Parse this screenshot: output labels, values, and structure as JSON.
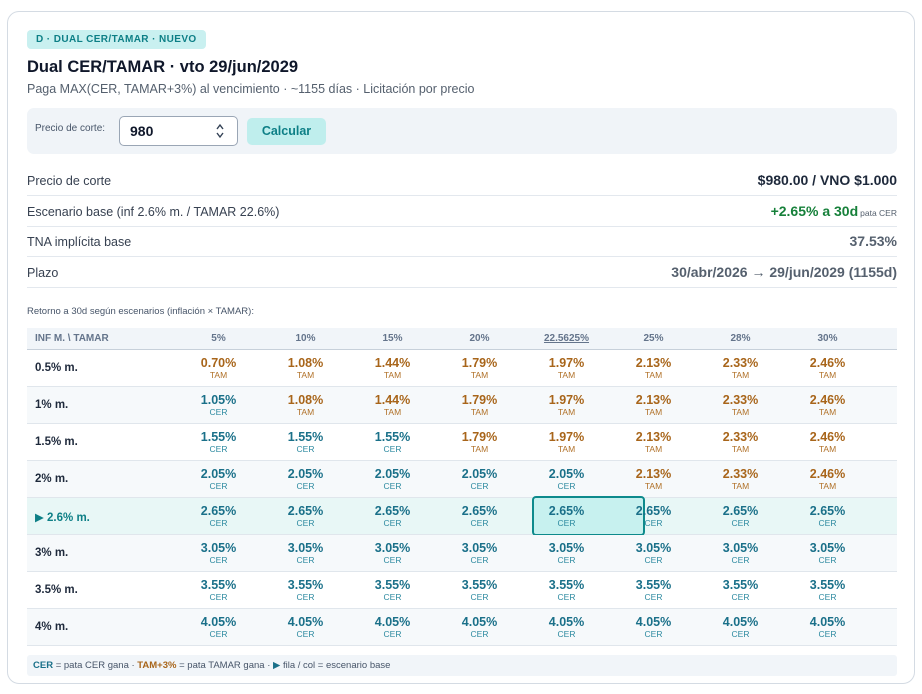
{
  "badge": "D · DUAL CER/TAMAR · NUEVO",
  "title": "Dual CER/TAMAR · vto 29/jun/2029",
  "subtitle": "Paga MAX(CER, TAMAR+3%) al vencimiento · ~1155 días · Licitación por precio",
  "calculator": {
    "label": "Precio de corte:",
    "input_value": "980",
    "button_label": "Calcular"
  },
  "summary": [
    {
      "label": "Precio de corte",
      "value": "$980.00 / VNO $1.000",
      "note": ""
    },
    {
      "label": "Escenario base (inf 2.6% m. / TAMAR 22.6%)",
      "value": "+2.65% a 30d",
      "note": "pata CER"
    },
    {
      "label": "TNA implícita base",
      "value": "37.53%",
      "note": ""
    },
    {
      "label": "Plazo",
      "value": "30/abr/2026 → 29/jun/2029 (1155d)",
      "note": ""
    }
  ],
  "scenario_caption": "Retorno a 30d según escenarios (inflación × TAMAR):",
  "grid": {
    "corner_header": "INF M. \\ TAMAR",
    "columns": [
      "5%",
      "10%",
      "15%",
      "20%",
      "22.5625%",
      "25%",
      "28%",
      "30%"
    ],
    "base_column_index": 4,
    "base_row_index": 4,
    "rows": [
      {
        "label": "0.5% m.",
        "cells": [
          {
            "v": "0.70%",
            "t": "TAM"
          },
          {
            "v": "1.08%",
            "t": "TAM"
          },
          {
            "v": "1.44%",
            "t": "TAM"
          },
          {
            "v": "1.79%",
            "t": "TAM"
          },
          {
            "v": "1.97%",
            "t": "TAM"
          },
          {
            "v": "2.13%",
            "t": "TAM"
          },
          {
            "v": "2.33%",
            "t": "TAM"
          },
          {
            "v": "2.46%",
            "t": "TAM"
          }
        ]
      },
      {
        "label": "1% m.",
        "cells": [
          {
            "v": "1.05%",
            "t": "CER"
          },
          {
            "v": "1.08%",
            "t": "TAM"
          },
          {
            "v": "1.44%",
            "t": "TAM"
          },
          {
            "v": "1.79%",
            "t": "TAM"
          },
          {
            "v": "1.97%",
            "t": "TAM"
          },
          {
            "v": "2.13%",
            "t": "TAM"
          },
          {
            "v": "2.33%",
            "t": "TAM"
          },
          {
            "v": "2.46%",
            "t": "TAM"
          }
        ]
      },
      {
        "label": "1.5% m.",
        "cells": [
          {
            "v": "1.55%",
            "t": "CER"
          },
          {
            "v": "1.55%",
            "t": "CER"
          },
          {
            "v": "1.55%",
            "t": "CER"
          },
          {
            "v": "1.79%",
            "t": "TAM"
          },
          {
            "v": "1.97%",
            "t": "TAM"
          },
          {
            "v": "2.13%",
            "t": "TAM"
          },
          {
            "v": "2.33%",
            "t": "TAM"
          },
          {
            "v": "2.46%",
            "t": "TAM"
          }
        ]
      },
      {
        "label": "2% m.",
        "cells": [
          {
            "v": "2.05%",
            "t": "CER"
          },
          {
            "v": "2.05%",
            "t": "CER"
          },
          {
            "v": "2.05%",
            "t": "CER"
          },
          {
            "v": "2.05%",
            "t": "CER"
          },
          {
            "v": "2.05%",
            "t": "CER"
          },
          {
            "v": "2.13%",
            "t": "TAM"
          },
          {
            "v": "2.33%",
            "t": "TAM"
          },
          {
            "v": "2.46%",
            "t": "TAM"
          }
        ]
      },
      {
        "label": "▶ 2.6% m.",
        "cells": [
          {
            "v": "2.65%",
            "t": "CER"
          },
          {
            "v": "2.65%",
            "t": "CER"
          },
          {
            "v": "2.65%",
            "t": "CER"
          },
          {
            "v": "2.65%",
            "t": "CER"
          },
          {
            "v": "2.65%",
            "t": "CER"
          },
          {
            "v": "2.65%",
            "t": "CER"
          },
          {
            "v": "2.65%",
            "t": "CER"
          },
          {
            "v": "2.65%",
            "t": "CER"
          }
        ]
      },
      {
        "label": "3% m.",
        "cells": [
          {
            "v": "3.05%",
            "t": "CER"
          },
          {
            "v": "3.05%",
            "t": "CER"
          },
          {
            "v": "3.05%",
            "t": "CER"
          },
          {
            "v": "3.05%",
            "t": "CER"
          },
          {
            "v": "3.05%",
            "t": "CER"
          },
          {
            "v": "3.05%",
            "t": "CER"
          },
          {
            "v": "3.05%",
            "t": "CER"
          },
          {
            "v": "3.05%",
            "t": "CER"
          }
        ]
      },
      {
        "label": "3.5% m.",
        "cells": [
          {
            "v": "3.55%",
            "t": "CER"
          },
          {
            "v": "3.55%",
            "t": "CER"
          },
          {
            "v": "3.55%",
            "t": "CER"
          },
          {
            "v": "3.55%",
            "t": "CER"
          },
          {
            "v": "3.55%",
            "t": "CER"
          },
          {
            "v": "3.55%",
            "t": "CER"
          },
          {
            "v": "3.55%",
            "t": "CER"
          },
          {
            "v": "3.55%",
            "t": "CER"
          }
        ]
      },
      {
        "label": "4% m.",
        "cells": [
          {
            "v": "4.05%",
            "t": "CER"
          },
          {
            "v": "4.05%",
            "t": "CER"
          },
          {
            "v": "4.05%",
            "t": "CER"
          },
          {
            "v": "4.05%",
            "t": "CER"
          },
          {
            "v": "4.05%",
            "t": "CER"
          },
          {
            "v": "4.05%",
            "t": "CER"
          },
          {
            "v": "4.05%",
            "t": "CER"
          },
          {
            "v": "4.05%",
            "t": "CER"
          }
        ]
      }
    ]
  },
  "legend": {
    "cer_key": "CER",
    "cer_text": " = pata CER gana · ",
    "tam_key": "TAM+3%",
    "tam_text": " = pata TAMAR gana · ",
    "arrow": "▶",
    "base_text": " fila / col = escenario base"
  },
  "colors": {
    "accent": "#0d7f86",
    "cer": "#1a7089",
    "tamar": "#a8651a",
    "positive": "#16803a"
  }
}
